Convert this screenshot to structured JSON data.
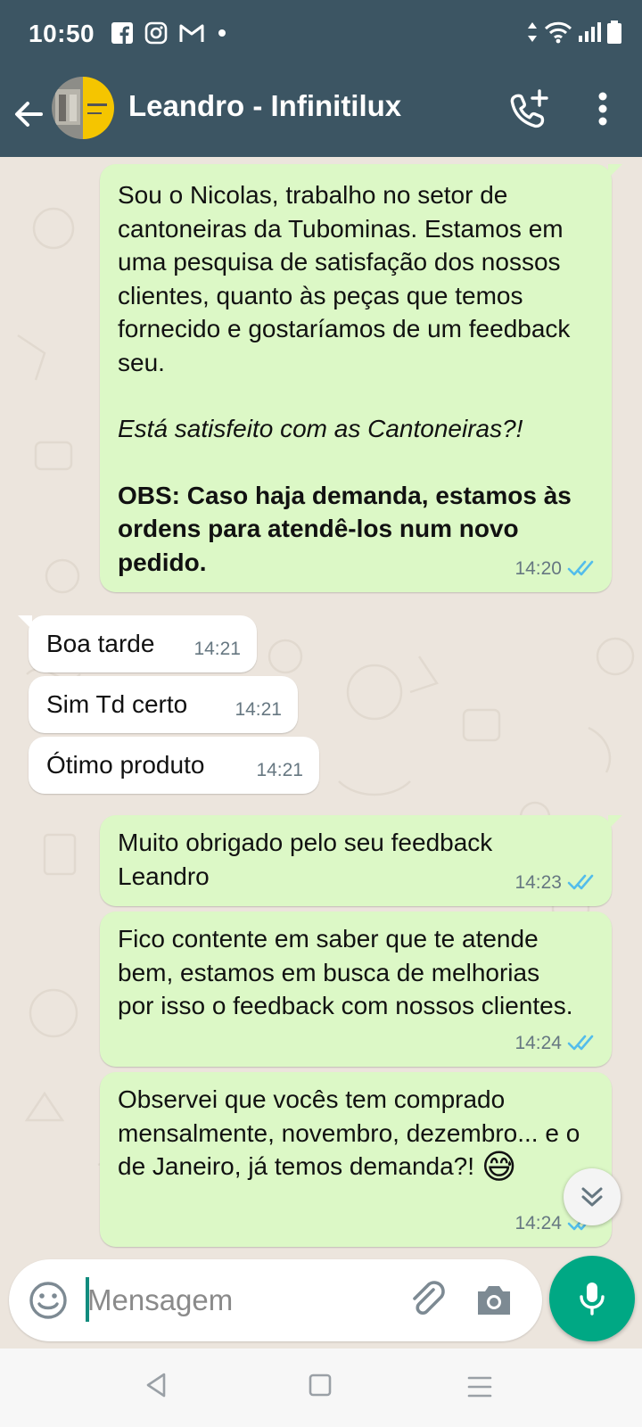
{
  "status_bar": {
    "time": "10:50",
    "notification_icons": [
      "facebook-icon",
      "instagram-icon",
      "gmail-icon",
      "dot-icon"
    ],
    "system_icons": [
      "data-arrows-icon",
      "wifi-icon",
      "signal-icon",
      "battery-icon"
    ]
  },
  "header": {
    "contact_name": "Leandro - Infinitilux",
    "icons": [
      "back-arrow-icon",
      "add-call-icon",
      "more-vert-icon"
    ]
  },
  "messages": [
    {
      "direction": "out",
      "paragraphs": [
        "Sou o Nicolas, trabalho no setor de cantoneiras da Tubominas. Estamos em uma pesquisa de satisfação dos nossos clientes, quanto às peças que temos fornecido e gostaríamos de um feedback seu.",
        "Está satisfeito com as Cantoneiras?!",
        "OBS: Caso haja demanda, estamos às ordens para atendê-los num novo pedido."
      ],
      "time": "14:20",
      "read": true
    },
    {
      "direction": "in",
      "text": "Boa tarde",
      "time": "14:21"
    },
    {
      "direction": "in",
      "text": "Sim Td certo",
      "time": "14:21"
    },
    {
      "direction": "in",
      "text": "Ótimo produto",
      "time": "14:21"
    },
    {
      "direction": "out",
      "text": "Muito obrigado pelo seu feedback Leandro",
      "time": "14:23",
      "read": true
    },
    {
      "direction": "out",
      "text": "Fico contente em saber que te atende bem, estamos em busca de melhorias por isso o feedback com nossos clientes.",
      "time": "14:24",
      "read": true
    },
    {
      "direction": "out",
      "text": "Observei que vocês tem comprado mensalmente, novembro, dezembro... e o de Janeiro, já temos demanda?!",
      "emoji": "😅",
      "time": "14:24",
      "read": true
    }
  ],
  "composer": {
    "placeholder": "Mensagem",
    "icons": [
      "emoji-icon",
      "attach-icon",
      "camera-icon",
      "mic-icon"
    ]
  },
  "colors": {
    "header": "#3c5563",
    "chat_background": "#ece5dd",
    "outgoing_bubble": "#dcf8c6",
    "incoming_bubble": "#ffffff",
    "accent": "#00a884",
    "read_ticks": "#53bdeb"
  }
}
